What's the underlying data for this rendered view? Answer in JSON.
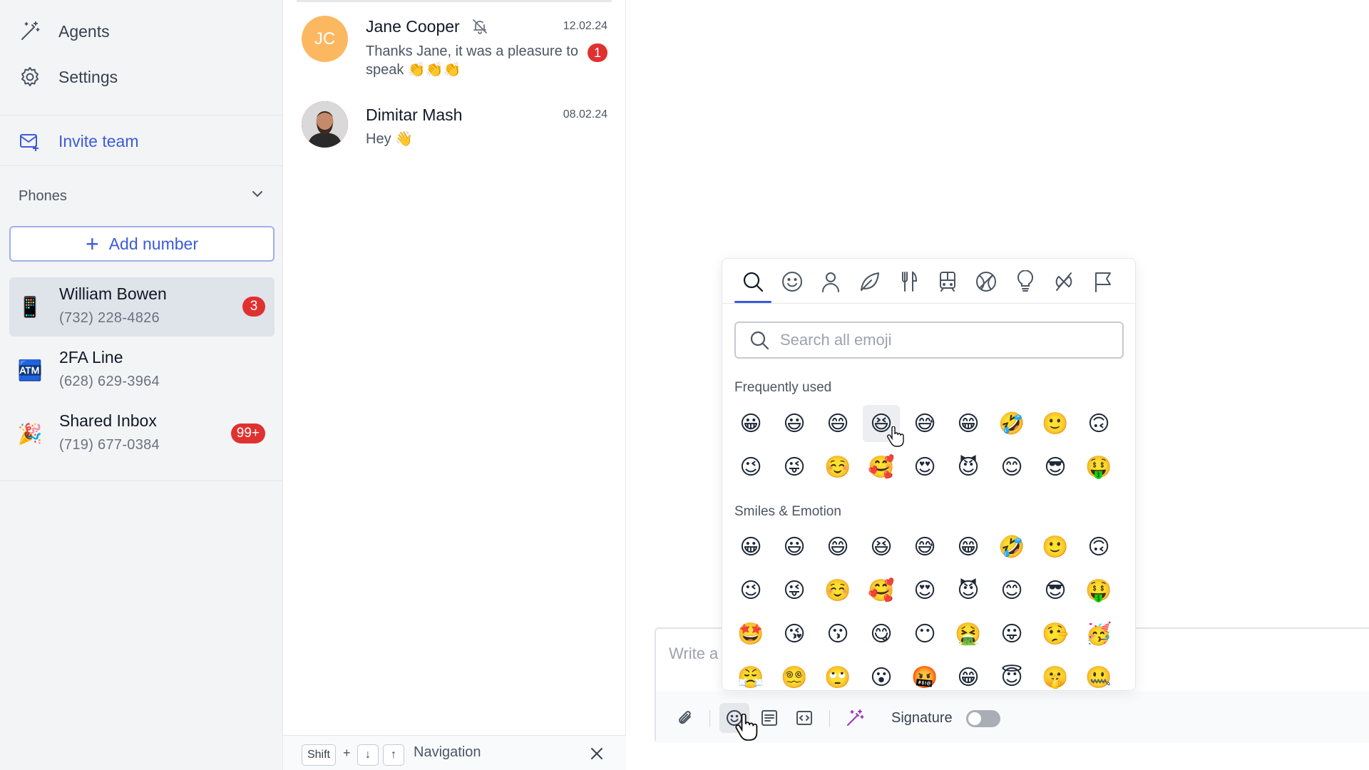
{
  "sidebar": {
    "nav": [
      {
        "label": "Agents",
        "icon": "magic-wand-icon"
      },
      {
        "label": "Settings",
        "icon": "gear-icon"
      },
      {
        "label": "Invite team",
        "icon": "mail-icon"
      }
    ],
    "phones_header": "Phones",
    "add_number_label": "Add number",
    "phones": [
      {
        "name": "William Bowen",
        "number": "(732) 228-4826",
        "icon": "📱",
        "badge": "3",
        "active": true
      },
      {
        "name": "2FA Line",
        "number": "(628) 629-3964",
        "icon": "🏧",
        "badge": "",
        "active": false
      },
      {
        "name": "Shared Inbox",
        "number": "(719) 677-0384",
        "icon": "🎉",
        "badge": "99+",
        "active": false
      }
    ]
  },
  "conversations": [
    {
      "name": "Jane Cooper",
      "initials": "JC",
      "date": "12.02.24",
      "message": "Thanks Jane, it was a pleasure to speak 👏👏👏",
      "muted": true,
      "unread": "1"
    },
    {
      "name": "Dimitar Mash",
      "initials": "",
      "date": "08.02.24",
      "message": "Hey 👋",
      "muted": false,
      "unread": ""
    }
  ],
  "hint": {
    "shift": "Shift",
    "plus": "+",
    "down": "↓",
    "up": "↑",
    "label": "Navigation"
  },
  "composer": {
    "placeholder": "Write a",
    "signature_label": "Signature",
    "signature_enabled": false
  },
  "emoji_picker": {
    "search_placeholder": "Search all emoji",
    "categories": [
      "search-icon",
      "smiley-icon",
      "person-icon",
      "leaf-icon",
      "utensils-icon",
      "train-icon",
      "ball-icon",
      "lightbulb-icon",
      "symbols-icon",
      "flag-icon"
    ],
    "active_category": "search-icon",
    "sections": [
      {
        "title": "Frequently used",
        "emojis": [
          "😀",
          "😃",
          "😄",
          "😆",
          "😅",
          "😁",
          "🤣",
          "🙂",
          "🙃",
          "😉",
          "😜",
          "☺️",
          "🥰",
          "😍",
          "😈",
          "😊",
          "😎",
          "🤑"
        ]
      },
      {
        "title": "Smiles & Emotion",
        "emojis": [
          "😀",
          "😃",
          "😄",
          "😆",
          "😅",
          "😁",
          "🤣",
          "🙂",
          "🙃",
          "😉",
          "😜",
          "☺️",
          "🥰",
          "😍",
          "😈",
          "😊",
          "😎",
          "🤑",
          "🤩",
          "😘",
          "😗",
          "😋",
          "😶",
          "🤮",
          "😛",
          "🤥",
          "🥳",
          "😤",
          "😵‍💫",
          "🙄",
          "😮",
          "🤬",
          "😁",
          "😇",
          "🤫",
          "🤐"
        ]
      }
    ]
  }
}
